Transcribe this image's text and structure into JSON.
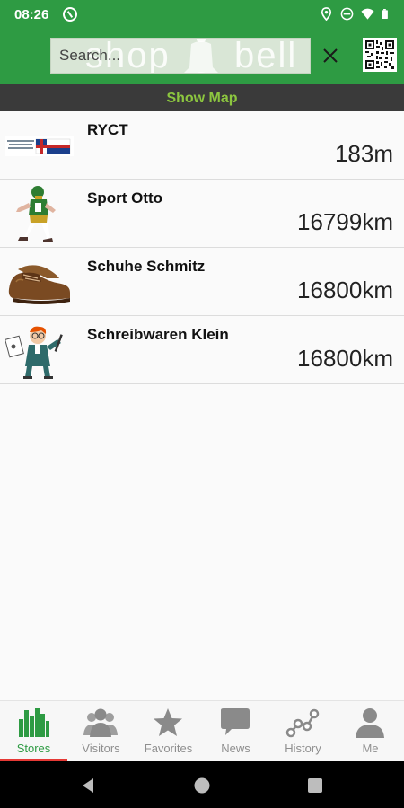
{
  "status_bar": {
    "time": "08:26",
    "icons": [
      "location-icon",
      "dnd-icon",
      "wifi-icon",
      "battery-icon"
    ]
  },
  "header": {
    "search_placeholder": "Search...",
    "logo_text_left": "shop",
    "logo_text_right": "bell",
    "clear_icon": "close-icon",
    "qr_icon": "qr-code-icon"
  },
  "map_button": {
    "label": "Show Map"
  },
  "stores": [
    {
      "name": "RYCT",
      "distance": "183m",
      "thumb": "yacht-club-logo"
    },
    {
      "name": "Sport Otto",
      "distance": "16799km",
      "thumb": "football-player"
    },
    {
      "name": "Schuhe Schmitz",
      "distance": "16800km",
      "thumb": "brown-shoe"
    },
    {
      "name": "Schreibwaren Klein",
      "distance": "16800km",
      "thumb": "writer-character"
    }
  ],
  "bottom_nav": {
    "items": [
      {
        "label": "Stores",
        "icon": "stores-icon",
        "active": true
      },
      {
        "label": "Visitors",
        "icon": "visitors-icon",
        "active": false
      },
      {
        "label": "Favorites",
        "icon": "star-icon",
        "active": false
      },
      {
        "label": "News",
        "icon": "chat-bubble-icon",
        "active": false
      },
      {
        "label": "History",
        "icon": "history-icon",
        "active": false
      },
      {
        "label": "Me",
        "icon": "person-icon",
        "active": false
      }
    ]
  },
  "colors": {
    "brand_green": "#2e9b43",
    "map_link": "#8cc63f",
    "active_indicator": "#e53935",
    "inactive_nav": "#8f8f8f"
  }
}
